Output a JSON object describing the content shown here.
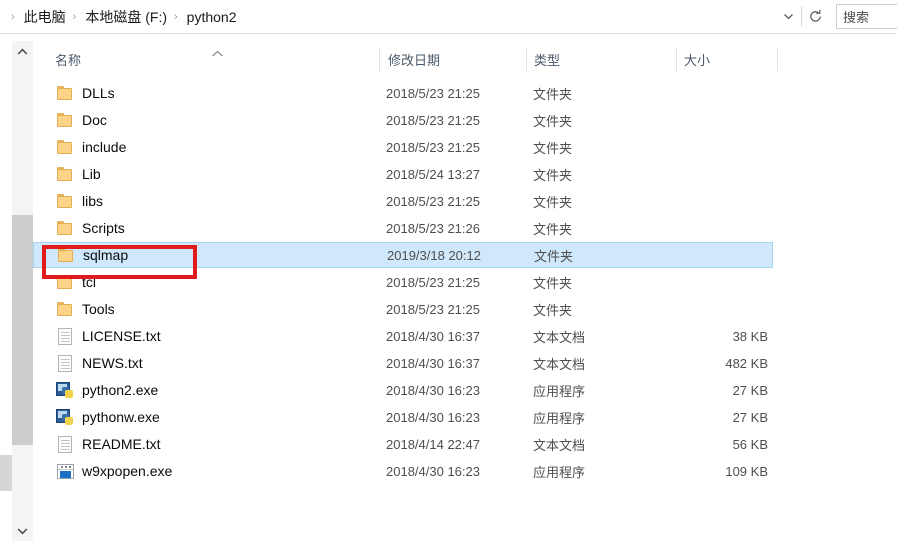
{
  "address_bar": {
    "breadcrumbs": [
      {
        "label": "此电脑"
      },
      {
        "label": "本地磁盘 (F:)"
      },
      {
        "label": "python2"
      }
    ],
    "separator": "›",
    "chevron_icon": "chevron-down-icon",
    "refresh_icon": "refresh-icon",
    "search_text": "搜索"
  },
  "columns": {
    "name": "名称",
    "date_modified": "修改日期",
    "type": "类型",
    "size": "大小",
    "sort_indicator": "sort-ascending-caret"
  },
  "files": [
    {
      "icon": "folder-icon",
      "name": "DLLs",
      "date": "2018/5/23 21:25",
      "type": "文件夹",
      "size": ""
    },
    {
      "icon": "folder-icon",
      "name": "Doc",
      "date": "2018/5/23 21:25",
      "type": "文件夹",
      "size": ""
    },
    {
      "icon": "folder-icon",
      "name": "include",
      "date": "2018/5/23 21:25",
      "type": "文件夹",
      "size": ""
    },
    {
      "icon": "folder-icon",
      "name": "Lib",
      "date": "2018/5/24 13:27",
      "type": "文件夹",
      "size": ""
    },
    {
      "icon": "folder-icon",
      "name": "libs",
      "date": "2018/5/23 21:25",
      "type": "文件夹",
      "size": ""
    },
    {
      "icon": "folder-icon",
      "name": "Scripts",
      "date": "2018/5/23 21:26",
      "type": "文件夹",
      "size": ""
    },
    {
      "icon": "folder-icon",
      "name": "sqlmap",
      "date": "2019/3/18 20:12",
      "type": "文件夹",
      "size": "",
      "selected": true,
      "annotated": true
    },
    {
      "icon": "folder-icon",
      "name": "tcl",
      "date": "2018/5/23 21:25",
      "type": "文件夹",
      "size": ""
    },
    {
      "icon": "folder-icon",
      "name": "Tools",
      "date": "2018/5/23 21:25",
      "type": "文件夹",
      "size": ""
    },
    {
      "icon": "document-icon",
      "name": "LICENSE.txt",
      "date": "2018/4/30 16:37",
      "type": "文本文档",
      "size": "38 KB"
    },
    {
      "icon": "document-icon",
      "name": "NEWS.txt",
      "date": "2018/4/30 16:37",
      "type": "文本文档",
      "size": "482 KB"
    },
    {
      "icon": "python-exe-icon",
      "name": "python2.exe",
      "date": "2018/4/30 16:23",
      "type": "应用程序",
      "size": "27 KB"
    },
    {
      "icon": "python-exe-icon",
      "name": "pythonw.exe",
      "date": "2018/4/30 16:23",
      "type": "应用程序",
      "size": "27 KB"
    },
    {
      "icon": "document-icon",
      "name": "README.txt",
      "date": "2018/4/14 22:47",
      "type": "文本文档",
      "size": "56 KB"
    },
    {
      "icon": "window-exe-icon",
      "name": "w9xpopen.exe",
      "date": "2018/4/30 16:23",
      "type": "应用程序",
      "size": "109 KB"
    }
  ],
  "scrollbar": {
    "up_arrow_icon": "chevron-up-icon",
    "down_arrow_icon": "chevron-down-icon"
  },
  "annotation": {
    "color": "#e11b1b",
    "target": "sqlmap"
  },
  "colors": {
    "selection": "#cfe8fb",
    "selection_border": "#a8d4f0",
    "annotation_red": "#e11b1b",
    "header_text": "#4a5a6a",
    "folder_yellow": "#fbd489"
  }
}
